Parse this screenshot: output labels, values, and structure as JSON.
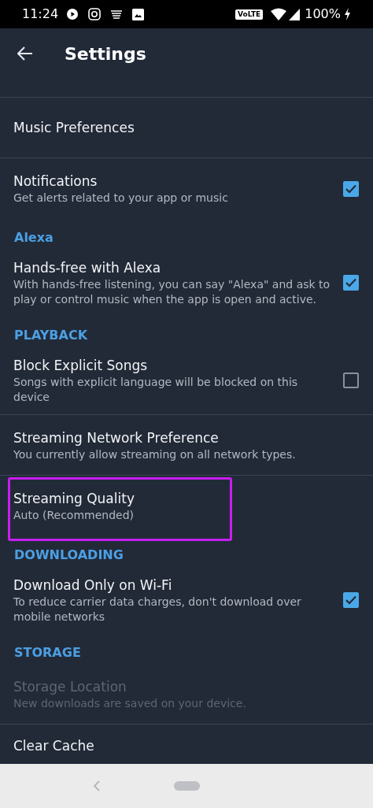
{
  "status_bar": {
    "time": "11:24",
    "network_badge": "VoLTE",
    "battery": "100%"
  },
  "app_bar": {
    "title": "Settings"
  },
  "items": [
    {
      "kind": "setting",
      "title": "Music Preferences",
      "disabled": false,
      "highlighted": false
    },
    {
      "kind": "setting",
      "title": "Notifications",
      "subtitle": "Get alerts related to your app or music",
      "checked": true,
      "disabled": false,
      "highlighted": false
    },
    {
      "kind": "header",
      "title": "Alexa"
    },
    {
      "kind": "setting",
      "title": "Hands-free with Alexa",
      "subtitle": "With hands-free listening, you can say \"Alexa\" and ask to play or control music when the app is open and active.",
      "checked": true,
      "disabled": false,
      "highlighted": false
    },
    {
      "kind": "header",
      "title": "PLAYBACK"
    },
    {
      "kind": "setting",
      "title": "Block Explicit Songs",
      "subtitle": "Songs with explicit language will be blocked on this device",
      "checked": false,
      "disabled": false,
      "highlighted": false
    },
    {
      "kind": "setting",
      "title": "Streaming Network Preference",
      "subtitle": "You currently allow streaming on all network types.",
      "disabled": false,
      "highlighted": false
    },
    {
      "kind": "setting",
      "title": "Streaming Quality",
      "subtitle": "Auto (Recommended)",
      "disabled": false,
      "highlighted": true
    },
    {
      "kind": "header",
      "title": "DOWNLOADING"
    },
    {
      "kind": "setting",
      "title": "Download Only on Wi-Fi",
      "subtitle": "To reduce carrier data charges, don't download over mobile networks",
      "checked": true,
      "disabled": false,
      "highlighted": false
    },
    {
      "kind": "header",
      "title": "STORAGE"
    },
    {
      "kind": "setting",
      "title": "Storage Location",
      "subtitle": "New downloads are saved on your device.",
      "disabled": true,
      "highlighted": false
    },
    {
      "kind": "setting",
      "title": "Clear Cache",
      "disabled": false,
      "highlighted": false
    }
  ]
}
